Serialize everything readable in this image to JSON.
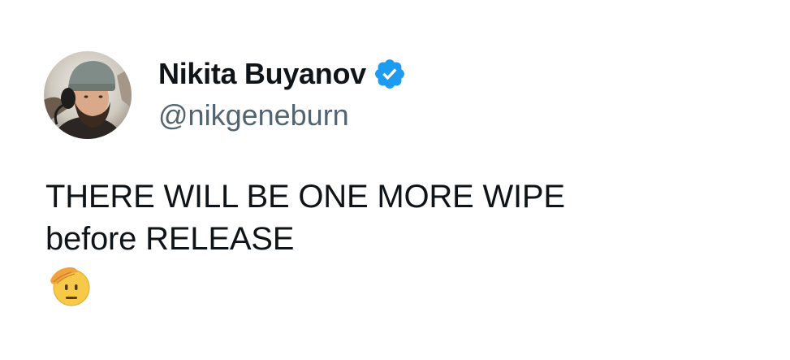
{
  "author": {
    "display_name": "Nikita Buyanov",
    "handle": "@nikgeneburn",
    "verified": true,
    "avatar_icon": "profile-photo"
  },
  "tweet": {
    "line1": "THERE WILL BE ONE MORE WIPE",
    "line2": "before RELEASE",
    "emoji": "saluting-face-emoji"
  },
  "colors": {
    "text": "#0f1419",
    "secondary_text": "#536471",
    "verified_blue": "#1d9bf0",
    "background": "#ffffff"
  }
}
